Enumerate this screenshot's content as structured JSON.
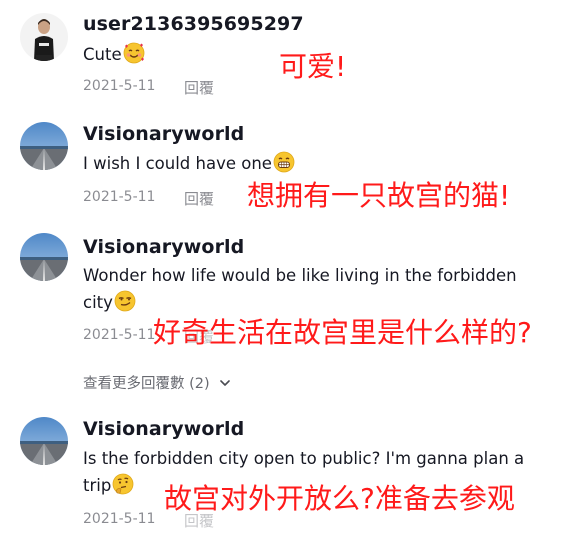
{
  "comments": [
    {
      "username": "user2136395695297",
      "text": "Cute",
      "emoji": "smiling-face-with-hearts",
      "date": "2021-5-11",
      "reply": "回覆",
      "annotation": "可爱!"
    },
    {
      "username": "Visionaryworld",
      "text": "I wish I could have one",
      "emoji": "grinning-face",
      "date": "2021-5-11",
      "reply": "回覆",
      "annotation": "想拥有一只故宫的猫!"
    },
    {
      "username": "Visionaryworld",
      "text_line1": "Wonder how life would be like living in the forbidden",
      "text_line2": "city",
      "emoji": "smirking-face",
      "date": "2021-5-11",
      "reply": "回覆",
      "annotation": "好奇生活在故宫里是什么样的?"
    },
    {
      "username": "Visionaryworld",
      "text_line1": "Is the forbidden city open to public? I'm ganna plan a",
      "text_line2": "trip",
      "emoji": "thinking-face",
      "date": "2021-5-11",
      "reply": "回覆",
      "annotation": "故宫对外开放么?准备去参观"
    }
  ],
  "view_more": {
    "label": "查看更多回覆數 (2)",
    "icon": "chevron-down-icon"
  },
  "colors": {
    "annotation": "#ff1a1a",
    "text": "#161823",
    "secondary": "#8a8b91",
    "emoji_yellow": "#f7c52f"
  }
}
